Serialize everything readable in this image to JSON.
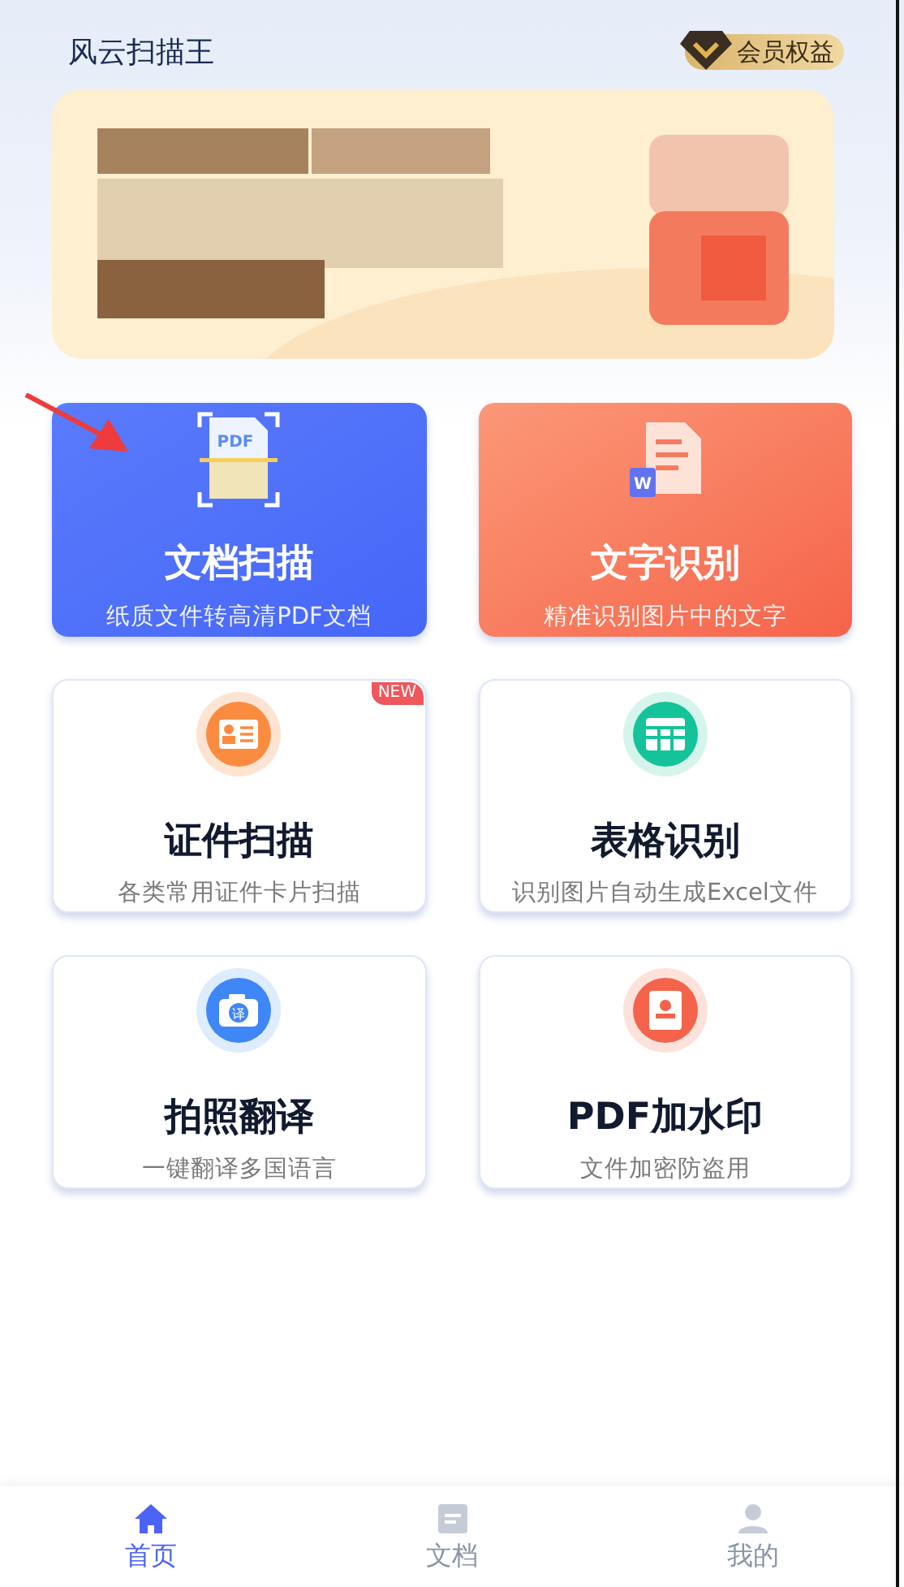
{
  "header": {
    "title": "风云扫描王",
    "member_badge": "会员权益"
  },
  "tools": [
    {
      "kind": "hero_blue",
      "icon_text": "PDF",
      "title": "文档扫描",
      "subtitle": "纸质文件转高清PDF文档"
    },
    {
      "kind": "hero_red",
      "icon_text": "W",
      "title": "文字识别",
      "subtitle": "精准识别图片中的文字"
    },
    {
      "kind": "plain",
      "title": "证件扫描",
      "subtitle": "各类常用证件卡片扫描",
      "badge": "NEW"
    },
    {
      "kind": "plain",
      "title": "表格识别",
      "subtitle": "识别图片自动生成Excel文件"
    },
    {
      "kind": "plain",
      "icon_text": "译",
      "title": "拍照翻译",
      "subtitle": "一键翻译多国语言"
    },
    {
      "kind": "plain",
      "title": "PDF加水印",
      "subtitle": "文件加密防盗用"
    }
  ],
  "bottom_nav": [
    {
      "label": "首页",
      "selected": true
    },
    {
      "label": "文档",
      "selected": false
    },
    {
      "label": "我的",
      "selected": false
    }
  ]
}
